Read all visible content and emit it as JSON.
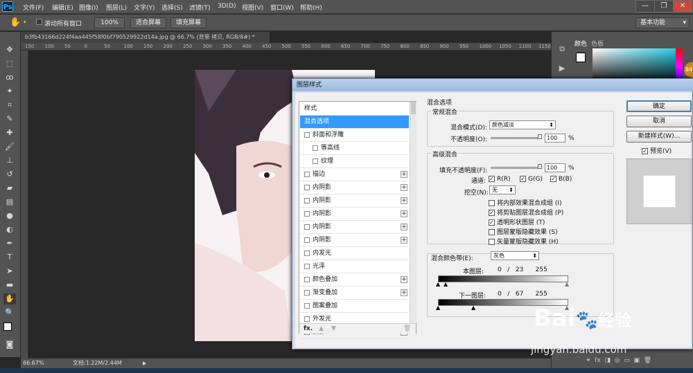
{
  "app": {
    "logo": "Ps"
  },
  "menu": [
    "文件(F)",
    "编辑(E)",
    "图像(I)",
    "图层(L)",
    "文字(Y)",
    "选择(S)",
    "滤镜(T)",
    "3D(D)",
    "视图(V)",
    "窗口(W)",
    "帮助(H)"
  ],
  "window_controls": {
    "minimize": "—",
    "restore": "❐",
    "close": "✕"
  },
  "options": {
    "scroll_all": "滚动所有窗口",
    "zoom": "100%",
    "fit_screen": "适合屏幕",
    "fill_screen": "填充屏幕",
    "workspace": "基本功能"
  },
  "document": {
    "tab_title": "b3fb43166d224f4aa445f58f0bf790529922d14a.jpg @ 66.7% (背景 拷贝, RGB/8#) *",
    "ruler_ticks": [
      "150",
      "100",
      "50",
      "0",
      "50",
      "100",
      "150",
      "200",
      "250",
      "300",
      "350",
      "400",
      "450",
      "500",
      "550",
      "600",
      "650",
      "700",
      "750",
      "800",
      "850",
      "900",
      "950",
      "1000",
      "1050",
      "1100",
      "1150"
    ]
  },
  "status": {
    "zoom": "66.67%",
    "doc_size": "文档:1.22M/2.44M"
  },
  "panel": {
    "tab_color": "颜色",
    "tab_swatches": "色板",
    "badge": "84"
  },
  "dialog": {
    "title": "图层样式",
    "styles": [
      {
        "label": "样式",
        "checkbox": false,
        "plus": false,
        "indent": 0,
        "selected": false
      },
      {
        "label": "混合选项",
        "checkbox": false,
        "plus": false,
        "indent": 0,
        "selected": true
      },
      {
        "label": "斜面和浮雕",
        "checkbox": true,
        "plus": false,
        "indent": 0,
        "selected": false
      },
      {
        "label": "等高线",
        "checkbox": true,
        "plus": false,
        "indent": 1,
        "selected": false
      },
      {
        "label": "纹理",
        "checkbox": true,
        "plus": false,
        "indent": 1,
        "selected": false
      },
      {
        "label": "描边",
        "checkbox": true,
        "plus": true,
        "indent": 0,
        "selected": false
      },
      {
        "label": "内阴影",
        "checkbox": true,
        "plus": true,
        "indent": 0,
        "selected": false
      },
      {
        "label": "内阴影",
        "checkbox": true,
        "plus": true,
        "indent": 0,
        "selected": false
      },
      {
        "label": "内阴影",
        "checkbox": true,
        "plus": true,
        "indent": 0,
        "selected": false
      },
      {
        "label": "内阴影",
        "checkbox": true,
        "plus": true,
        "indent": 0,
        "selected": false
      },
      {
        "label": "内阴影",
        "checkbox": true,
        "plus": true,
        "indent": 0,
        "selected": false
      },
      {
        "label": "内发光",
        "checkbox": true,
        "plus": false,
        "indent": 0,
        "selected": false
      },
      {
        "label": "光泽",
        "checkbox": true,
        "plus": false,
        "indent": 0,
        "selected": false
      },
      {
        "label": "颜色叠加",
        "checkbox": true,
        "plus": true,
        "indent": 0,
        "selected": false
      },
      {
        "label": "渐变叠加",
        "checkbox": true,
        "plus": true,
        "indent": 0,
        "selected": false
      },
      {
        "label": "图案叠加",
        "checkbox": true,
        "plus": false,
        "indent": 0,
        "selected": false
      },
      {
        "label": "外发光",
        "checkbox": true,
        "plus": false,
        "indent": 0,
        "selected": false
      },
      {
        "label": "投影",
        "checkbox": true,
        "plus": true,
        "indent": 0,
        "selected": false
      }
    ],
    "list_footer": {
      "fx": "fx.",
      "up": "▲",
      "down": "▼",
      "trash": "🗑"
    },
    "blend_section": "混合选项",
    "general_blending": "常规混合",
    "blend_mode_label": "混合模式(D):",
    "blend_mode_value": "颜色减淡",
    "opacity_label": "不透明度(O):",
    "opacity_value": "100",
    "percent": "%",
    "advanced_blending": "高级混合",
    "fill_opacity_label": "填充不透明度(F):",
    "fill_opacity_value": "100",
    "channels_label": "通道:",
    "channels": [
      "R(R)",
      "G(G)",
      "B(B)"
    ],
    "knockout_label": "挖空(N):",
    "knockout_value": "无",
    "options": [
      {
        "label": "将内部效果混合成组 (I)",
        "checked": false
      },
      {
        "label": "将剪贴图层混合成组 (P)",
        "checked": true
      },
      {
        "label": "透明形状图层 (T)",
        "checked": true
      },
      {
        "label": "图层蒙版隐藏效果 (S)",
        "checked": false
      },
      {
        "label": "矢量蒙版隐藏效果 (H)",
        "checked": false
      }
    ],
    "blend_if_label": "混合颜色带(E):",
    "blend_if_value": "灰色",
    "this_layer_label": "本图层:",
    "this_layer_values": "0   /   23      255",
    "underlying_label": "下一图层:",
    "underlying_values": "0   /   67      255",
    "buttons": {
      "ok": "确定",
      "cancel": "取消",
      "new_style": "新建样式(W)...",
      "preview": "预览(V)"
    }
  },
  "watermark": {
    "brand": "Bai",
    "brand2": "经验",
    "url": "jingyan.baidu.com"
  }
}
